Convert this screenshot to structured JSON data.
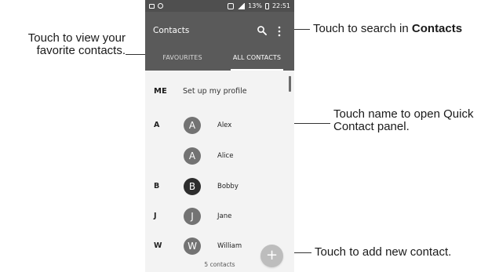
{
  "callouts": {
    "left_favorites_line1": "Touch to view your",
    "left_favorites_line2": "favorite contacts.",
    "top_search_prefix": "Touch to search in ",
    "top_search_bold": "Contacts",
    "middle_quick_line1": "Touch name to open Quick",
    "middle_quick_line2": "Contact panel.",
    "bottom_add": "Touch to add new contact."
  },
  "status_bar": {
    "battery": "13%",
    "time": "22:51"
  },
  "app_bar": {
    "title": "Contacts",
    "search_icon": "search-icon",
    "menu_icon": "more-vert-icon"
  },
  "tabs": [
    {
      "label": "FAVOURITES",
      "active": false
    },
    {
      "label": "ALL CONTACTS",
      "active": true
    }
  ],
  "profile": {
    "label": "ME",
    "text": "Set up my profile"
  },
  "contacts": [
    {
      "section": "A",
      "initial": "A",
      "name": "Alex",
      "avatar": "medium"
    },
    {
      "section": "",
      "initial": "A",
      "name": "Alice",
      "avatar": "medium"
    },
    {
      "section": "B",
      "initial": "B",
      "name": "Bobby",
      "avatar": "dark"
    },
    {
      "section": "J",
      "initial": "J",
      "name": "Jane",
      "avatar": "medium"
    },
    {
      "section": "W",
      "initial": "W",
      "name": "William",
      "avatar": "medium"
    }
  ],
  "contacts_count": "5 contacts",
  "fab": {
    "label": "+"
  },
  "colors": {
    "app_bar": "#5a5a5a",
    "status_bar": "#4f4f4f",
    "background": "#f3f3f3",
    "avatar": "#737373",
    "avatar_dark": "#2d2d2d",
    "fab": "#bdbdbd"
  }
}
